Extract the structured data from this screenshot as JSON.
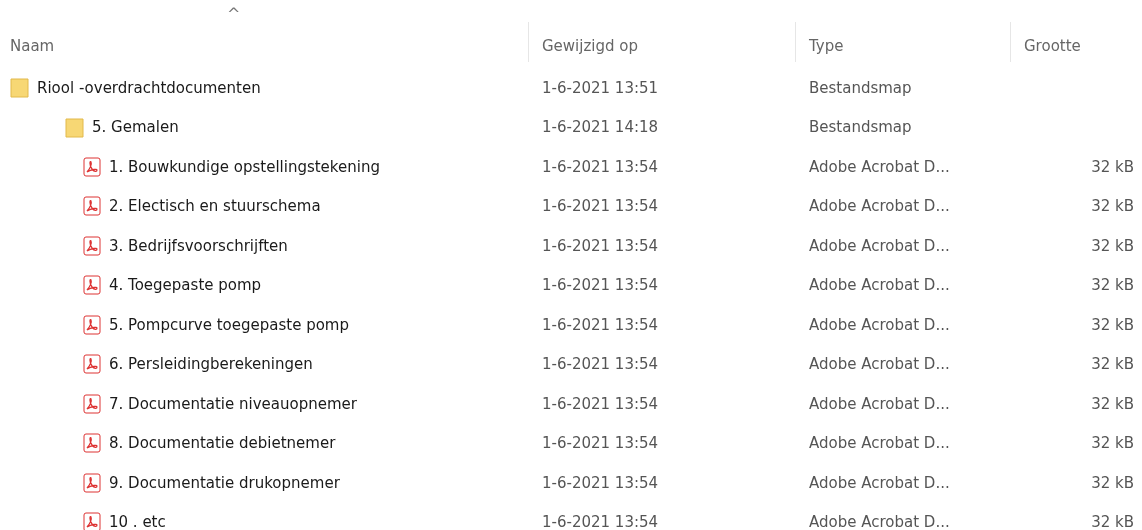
{
  "columns": [
    {
      "label": "Naam",
      "sorted": true
    },
    {
      "label": "Gewijzigd op",
      "sorted": false
    },
    {
      "label": "Type",
      "sorted": false
    },
    {
      "label": "Grootte",
      "sorted": false
    }
  ],
  "sort_indicator": "^",
  "items": [
    {
      "kind": "folder",
      "name": "Riool -overdrachtdocumenten",
      "modified": "1-6-2021 13:51",
      "type": "Bestandsmap",
      "children": [
        {
          "kind": "folder",
          "name": "5. Gemalen",
          "modified": "1-6-2021 14:18",
          "type": "Bestandsmap",
          "children": [
            {
              "kind": "pdf",
              "name": "1. Bouwkundige opstellingstekening",
              "modified": "1-6-2021 13:54",
              "type": "Adobe Acrobat D...",
              "size": "32 kB"
            },
            {
              "kind": "pdf",
              "name": "2. Electisch en stuurschema",
              "modified": "1-6-2021 13:54",
              "type": "Adobe Acrobat D...",
              "size": "32 kB"
            },
            {
              "kind": "pdf",
              "name": "3. Bedrijfsvoorschrijften",
              "modified": "1-6-2021 13:54",
              "type": "Adobe Acrobat D...",
              "size": "32 kB"
            },
            {
              "kind": "pdf",
              "name": "4. Toegepaste pomp",
              "modified": "1-6-2021 13:54",
              "type": "Adobe Acrobat D...",
              "size": "32 kB"
            },
            {
              "kind": "pdf",
              "name": "5. Pompcurve toegepaste pomp",
              "modified": "1-6-2021 13:54",
              "type": "Adobe Acrobat D...",
              "size": "32 kB"
            },
            {
              "kind": "pdf",
              "name": "6. Persleidingberekeningen",
              "modified": "1-6-2021 13:54",
              "type": "Adobe Acrobat D...",
              "size": "32 kB"
            },
            {
              "kind": "pdf",
              "name": "7. Documentatie niveauopnemer",
              "modified": "1-6-2021 13:54",
              "type": "Adobe Acrobat D...",
              "size": "32 kB"
            },
            {
              "kind": "pdf",
              "name": "8. Documentatie debietnemer",
              "modified": "1-6-2021 13:54",
              "type": "Adobe Acrobat D...",
              "size": "32 kB"
            },
            {
              "kind": "pdf",
              "name": "9. Documentatie drukopnemer",
              "modified": "1-6-2021 13:54",
              "type": "Adobe Acrobat D...",
              "size": "32 kB"
            },
            {
              "kind": "pdf",
              "name": "10 . etc",
              "modified": "1-6-2021 13:54",
              "type": "Adobe Acrobat D...",
              "size": "32 kB"
            }
          ]
        }
      ]
    }
  ]
}
